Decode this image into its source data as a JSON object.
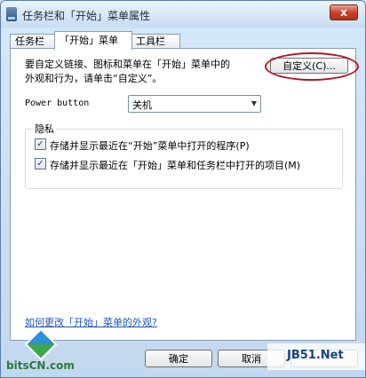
{
  "window": {
    "title": "任务栏和「开始」菜单属性",
    "close_glyph": "x"
  },
  "tabs": [
    {
      "label": "任务栏"
    },
    {
      "label": "「开始」菜单"
    },
    {
      "label": "工具栏"
    }
  ],
  "start_menu": {
    "description_line1": "要自定义链接、图标和菜单在「开始」菜单中的",
    "description_line2": "外观和行为，请单击“自定义”。",
    "customize_label": "自定义(C)...",
    "power_label": "Power button",
    "power_value": "关机",
    "privacy_title": "隐私",
    "privacy_items": [
      {
        "label": "存储并显示最近在“开始”菜单中打开的程序(P)",
        "checked": true
      },
      {
        "label": "存储并显示最近在「开始」菜单和任务栏中打开的项目(M)",
        "checked": true
      }
    ],
    "help_link": "如何更改「开始」菜单的外观?"
  },
  "footer": {
    "ok_label": "确定",
    "cancel_label": "取消",
    "apply_label": ""
  },
  "watermarks": {
    "left_text": "bitsCN.com",
    "right_text": "JB51.Net"
  },
  "check_glyph": "✓",
  "dropdown_arrow": "▼"
}
